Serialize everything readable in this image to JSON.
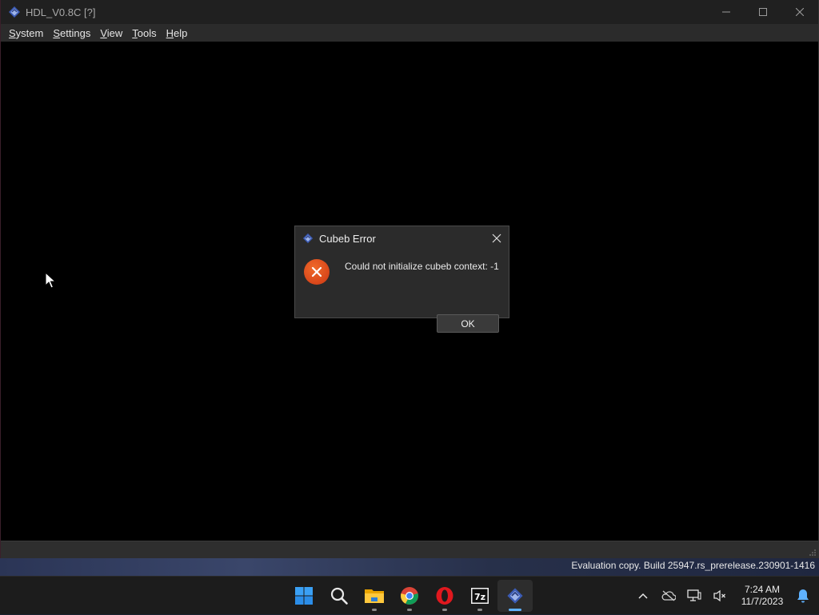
{
  "window": {
    "title": "HDL_V0.8C [?]",
    "icon": "app-diamond-icon",
    "controls": [
      "minimize-icon",
      "maximize-icon",
      "close-icon"
    ]
  },
  "menubar": {
    "items": [
      {
        "label": "System",
        "first": "S",
        "rest": "ystem"
      },
      {
        "label": "Settings",
        "first": "S",
        "rest": "ettings"
      },
      {
        "label": "View",
        "first": "V",
        "rest": "iew"
      },
      {
        "label": "Tools",
        "first": "T",
        "rest": "ools"
      },
      {
        "label": "Help",
        "first": "H",
        "rest": "elp"
      }
    ]
  },
  "dialog": {
    "title": "Cubeb Error",
    "message": "Could not initialize cubeb context: -1",
    "ok_label": "OK",
    "icon": "error-icon",
    "error_color": "#e0501c"
  },
  "desktop": {
    "watermark": "Evaluation copy. Build 25947.rs_prerelease.230901-1416"
  },
  "taskbar": {
    "apps": [
      {
        "name": "start-icon",
        "running": false
      },
      {
        "name": "search-icon",
        "running": false
      },
      {
        "name": "file-explorer-icon",
        "running": true
      },
      {
        "name": "chrome-icon",
        "running": true
      },
      {
        "name": "opera-icon",
        "running": true
      },
      {
        "name": "7zip-icon",
        "running": true
      },
      {
        "name": "app-diamond-icon",
        "running": true,
        "active": true
      }
    ],
    "tray": [
      "chevron-up-icon",
      "onedrive-off-icon",
      "network-icon",
      "volume-muted-icon"
    ],
    "time": "7:24 AM",
    "date": "11/7/2023",
    "accent": "#5fb2ff"
  }
}
